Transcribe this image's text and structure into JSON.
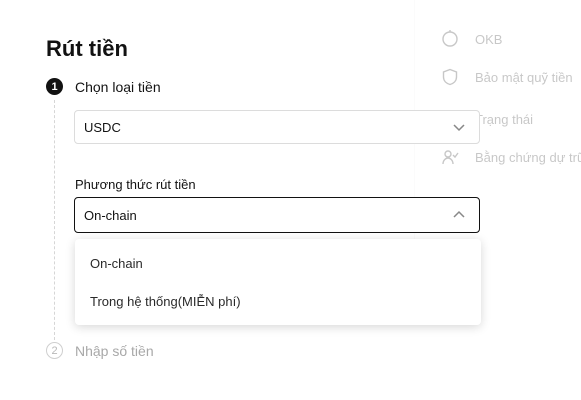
{
  "page": {
    "title": "Rút tiền"
  },
  "side_panel": {
    "items": [
      {
        "label": "OKB",
        "icon": "okb-icon"
      },
      {
        "label": "Bảo mật quỹ tiền",
        "icon": "shield-icon"
      },
      {
        "label": "Trạng thái",
        "icon": "status-icon"
      },
      {
        "label": "Bằng chứng dự trữ",
        "icon": "reserve-icon"
      }
    ]
  },
  "steps": [
    {
      "number": "1",
      "label": "Chọn loại tiền",
      "active": true
    },
    {
      "number": "2",
      "label": "Nhập số tiền",
      "active": false
    }
  ],
  "currency_select": {
    "value": "USDC",
    "icon": "chevron-down-icon"
  },
  "method": {
    "label": "Phương thức rút tiền",
    "value": "On-chain",
    "icon": "chevron-up-icon",
    "options": [
      "On-chain",
      "Trong hệ thống(MIỄN phí)"
    ]
  },
  "colors": {
    "text": "#121212",
    "muted": "#a8a8a8",
    "border": "#dcdcdc",
    "focus_border": "#121212"
  }
}
